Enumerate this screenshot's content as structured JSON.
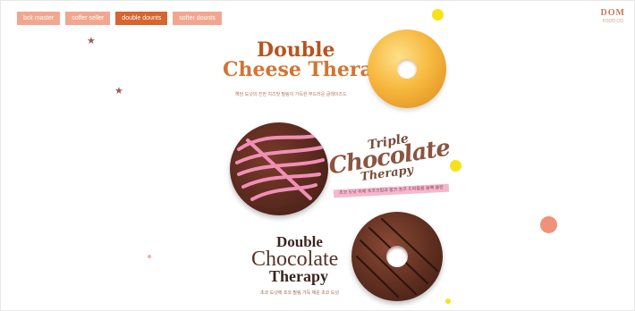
{
  "nav": {
    "tabs": [
      {
        "label": "bck master",
        "active": false
      },
      {
        "label": "soffer seller",
        "active": false
      },
      {
        "label": "double dounts",
        "active": true
      },
      {
        "label": "softer dounts",
        "active": false
      }
    ]
  },
  "brand": {
    "logo_main": "DOM",
    "logo_sub": "FOOD CO"
  },
  "products": [
    {
      "title_line1": "Double",
      "title_line2": "Cheese Therapy",
      "subtitle": "해당 도넛의 진한 치즈맛 필링이 가득한 부드러운 글레이즈드"
    },
    {
      "title_line1": "Triple",
      "title_line2": "Chocolate",
      "title_line3": "Therapy",
      "subtitle": "초코 도넛 위에 초코크림과 핑크 초코 드리즐을 듬뿍 올린"
    },
    {
      "title_line1": "Double",
      "title_line2": "Chocolate",
      "title_line3": "Therapy",
      "subtitle": "초코 도넛에 초코 필링 가득 채운 초코 도넛"
    }
  ],
  "colors": {
    "accent": "#d8642f",
    "tab": "#f2a690",
    "chocolate": "#5a2a1e",
    "glaze": "#f5b445"
  },
  "icons": [
    "star-icon",
    "dot-decoration"
  ]
}
